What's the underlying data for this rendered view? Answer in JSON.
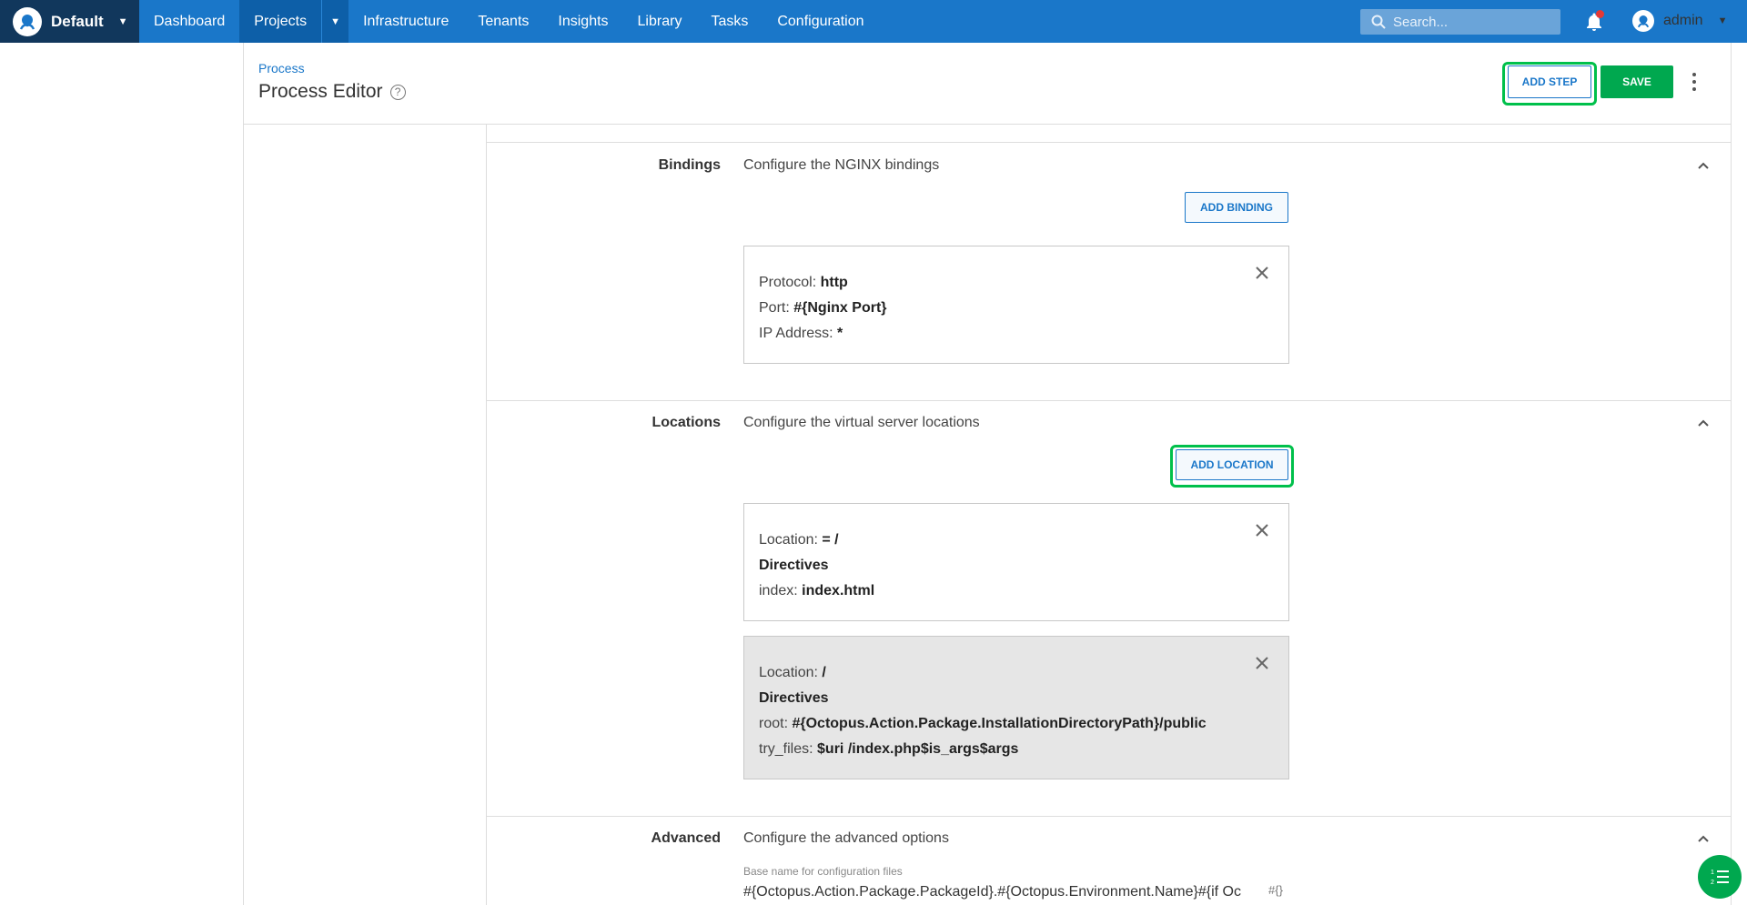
{
  "nav": {
    "space_name": "Default",
    "items": [
      "Dashboard",
      "Projects",
      "Infrastructure",
      "Tenants",
      "Insights",
      "Library",
      "Tasks",
      "Configuration"
    ],
    "search_placeholder": "Search...",
    "user": "admin"
  },
  "header": {
    "breadcrumb": "Process",
    "title": "Process Editor",
    "add_step": "ADD STEP",
    "save": "SAVE"
  },
  "bindings": {
    "label": "Bindings",
    "description": "Configure the NGINX bindings",
    "add_button": "ADD BINDING",
    "card": {
      "protocol_label": "Protocol:",
      "protocol": "http",
      "port_label": "Port:",
      "port": "#{Nginx Port}",
      "ip_label": "IP Address:",
      "ip": "*"
    }
  },
  "locations": {
    "label": "Locations",
    "description": "Configure the virtual server locations",
    "add_button": "ADD LOCATION",
    "items": [
      {
        "location_label": "Location:",
        "location": "= /",
        "directives_label": "Directives",
        "lines": [
          {
            "key": "index:",
            "value": "index.html"
          }
        ]
      },
      {
        "location_label": "Location:",
        "location": "/",
        "directives_label": "Directives",
        "lines": [
          {
            "key": "root:",
            "value": "#{Octopus.Action.Package.InstallationDirectoryPath}/public"
          },
          {
            "key": "try_files:",
            "value": "$uri /index.php$is_args$args"
          }
        ]
      }
    ]
  },
  "advanced": {
    "label": "Advanced",
    "description": "Configure the advanced options",
    "field_label": "Base name for configuration files",
    "field_value": "#{Octopus.Action.Package.PackageId}.#{Octopus.Environment.Name}#{if Oc",
    "var_icon": "#{}"
  },
  "colors": {
    "nav_bg": "#1a77c9",
    "space_bg": "#11375c",
    "accent_green": "#00a84f",
    "highlight_ring": "#00c04b"
  }
}
